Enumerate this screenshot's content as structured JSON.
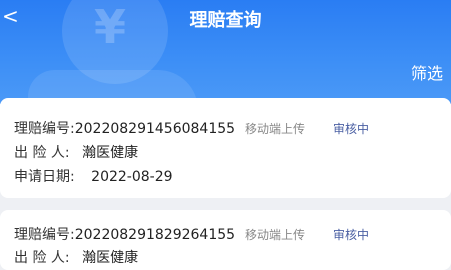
{
  "header": {
    "title": "理赔查询",
    "back_icon": "chevron-left-icon",
    "filter_label": "筛选",
    "background_color": "#2f84f4"
  },
  "claims": [
    {
      "number_label": "理赔编号:",
      "number": "202208291456084155",
      "source": "移动端上传",
      "status": "审核中",
      "insured_label": "出 险 人:",
      "insured": "瀚医健康",
      "date_label": "申请日期:",
      "date": "2022-08-29"
    },
    {
      "number_label": "理赔编号:",
      "number": "202208291829264155",
      "source": "移动端上传",
      "status": "审核中",
      "insured_label": "出 险 人:",
      "insured": "瀚医健康"
    }
  ]
}
